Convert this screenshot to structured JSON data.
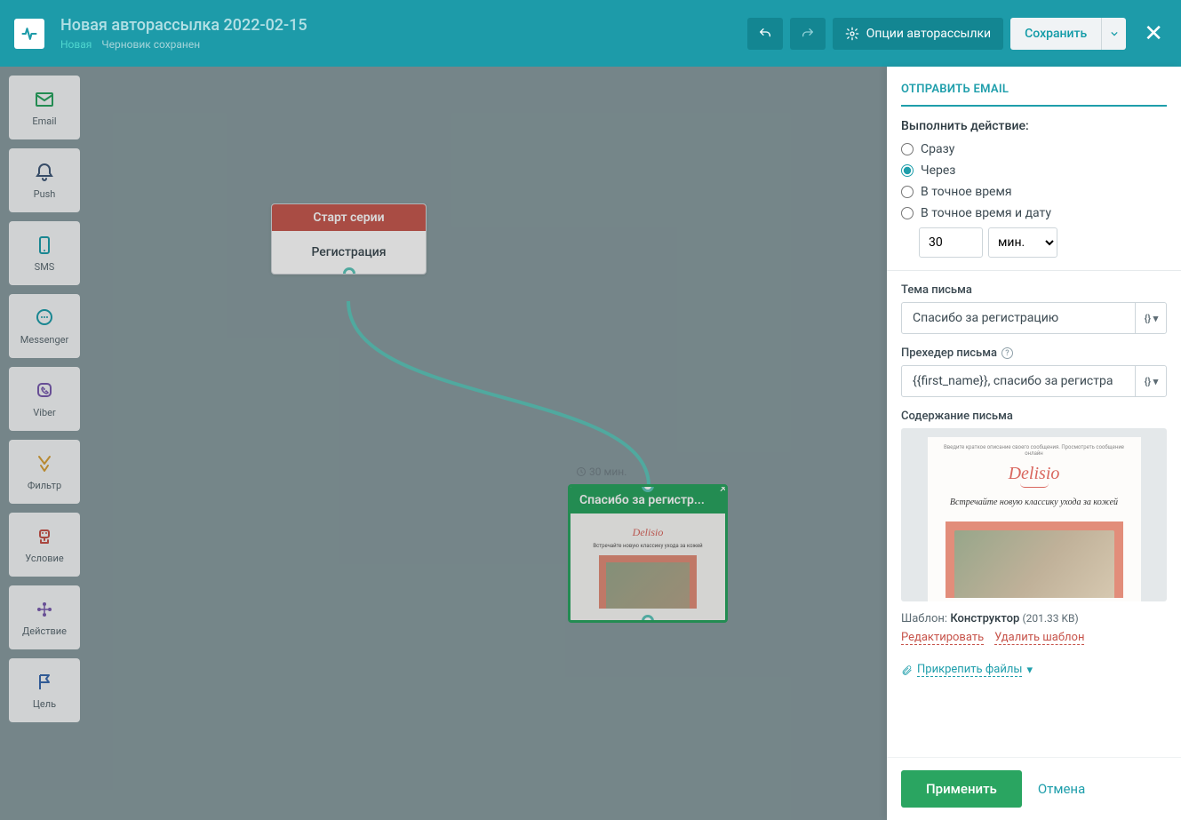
{
  "header": {
    "title": "Новая авторассылка 2022-02-15",
    "status_new": "Новая",
    "status_draft": "Черновик сохранен",
    "options": "Опции авторассылки",
    "save": "Сохранить"
  },
  "tools": [
    {
      "label": "Email",
      "icon": "email-icon",
      "color": "#2aa561"
    },
    {
      "label": "Push",
      "icon": "push-icon",
      "color": "#415a7a"
    },
    {
      "label": "SMS",
      "icon": "sms-icon",
      "color": "#1e9eab"
    },
    {
      "label": "Messenger",
      "icon": "messenger-icon",
      "color": "#1e9eab"
    },
    {
      "label": "Viber",
      "icon": "viber-icon",
      "color": "#7a5caf"
    },
    {
      "label": "Фильтр",
      "icon": "filter-icon",
      "color": "#d8a23a"
    },
    {
      "label": "Условие",
      "icon": "condition-icon",
      "color": "#c7544b"
    },
    {
      "label": "Действие",
      "icon": "action-icon",
      "color": "#7a5caf"
    },
    {
      "label": "Цель",
      "icon": "goal-icon",
      "color": "#3a6bb0"
    }
  ],
  "canvas": {
    "start": {
      "header": "Старт серии",
      "body": "Регистрация"
    },
    "email": {
      "header": "Спасибо за регистр...",
      "delay": "30 мин."
    },
    "preview_logo": "Delisio",
    "preview_tagline": "Встречайте новую классику ухода за кожей"
  },
  "panel": {
    "title": "ОТПРАВИТЬ EMAIL",
    "action_lbl": "Выполнить действие:",
    "radios": {
      "immediate": "Сразу",
      "after": "Через",
      "exact_time": "В точное время",
      "exact_datetime": "В точное время и дату"
    },
    "delay_value": "30",
    "delay_unit": "мин.",
    "subject_lbl": "Тема письма",
    "subject_val": "Спасибо за регистрацию",
    "preheader_lbl": "Прехедер письма",
    "preheader_val": "{{first_name}}, спасибо за регистра",
    "content_lbl": "Содержание письма",
    "template_lbl": "Шаблон:",
    "template_name": "Конструктор",
    "template_size": "(201.33 KB)",
    "edit_link": "Редактировать",
    "delete_link": "Удалить шаблон",
    "attach_link": "Прикрепить файлы",
    "apply": "Применить",
    "cancel": "Отмена",
    "vars_btn": "{} ▾"
  }
}
